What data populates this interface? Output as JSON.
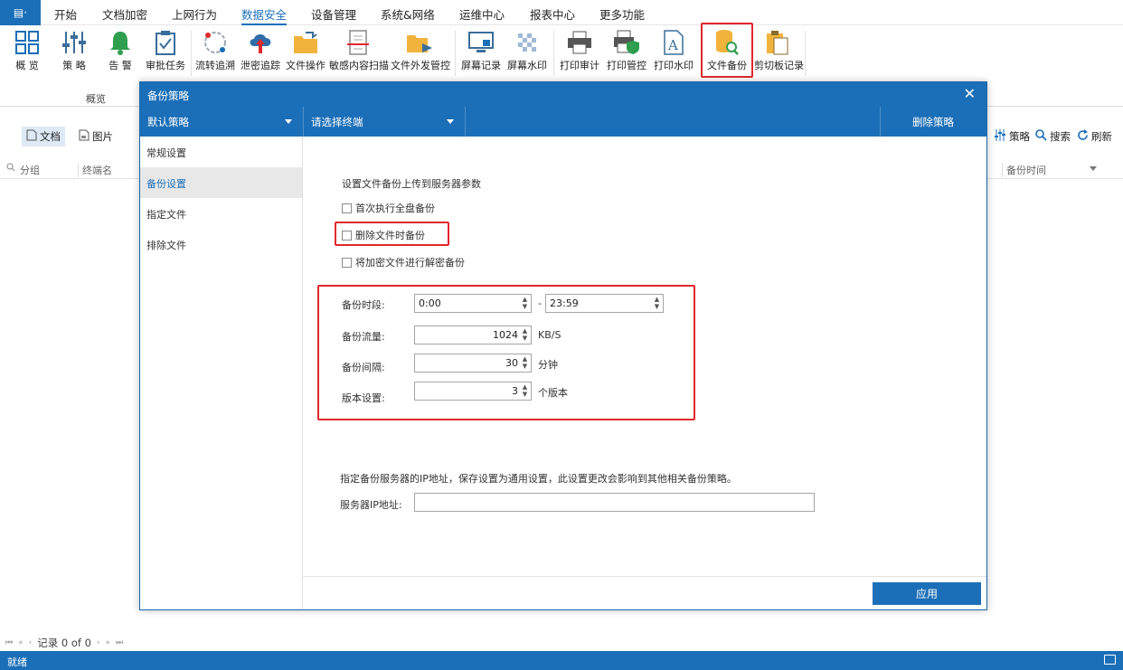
{
  "menubar": {
    "app_button": "▤·",
    "items": [
      "开始",
      "文档加密",
      "上网行为",
      "数据安全",
      "设备管理",
      "系统&网络",
      "运维中心",
      "报表中心",
      "更多功能"
    ],
    "active_index": 3
  },
  "ribbon": {
    "buttons": [
      {
        "label": "概 览",
        "icon": "overview-grid-icon"
      },
      {
        "label": "策 略",
        "icon": "sliders-icon"
      },
      {
        "label": "告 警",
        "icon": "bell-icon"
      },
      {
        "label": "审批任务",
        "icon": "clipboard-check-icon"
      },
      {
        "label": "流转追溯",
        "icon": "trace-circle-icon"
      },
      {
        "label": "泄密追踪",
        "icon": "cloud-upload-icon"
      },
      {
        "label": "文件操作",
        "icon": "folder-icon"
      },
      {
        "label": "敏感内容扫描",
        "icon": "document-scan-icon"
      },
      {
        "label": "文件外发管控",
        "icon": "folder-arrow-icon"
      },
      {
        "label": "屏幕记录",
        "icon": "monitor-icon"
      },
      {
        "label": "屏幕水印",
        "icon": "checker-icon"
      },
      {
        "label": "打印审计",
        "icon": "printer-icon"
      },
      {
        "label": "打印管控",
        "icon": "printer-shield-icon"
      },
      {
        "label": "打印水印",
        "icon": "document-a-icon"
      },
      {
        "label": "文件备份",
        "icon": "database-search-icon"
      },
      {
        "label": "剪切板记录",
        "icon": "clipboard-icon"
      }
    ],
    "selected_index": 14,
    "group_label": "概览"
  },
  "toolbar": {
    "doc": "文档",
    "image": "图片",
    "policy": "策略",
    "search": "搜索",
    "refresh": "刷新"
  },
  "columns": {
    "group": "分组",
    "terminal": "终端名",
    "backup_time": "备份时间"
  },
  "pager": {
    "text": "记录 0 of 0"
  },
  "status": {
    "text": "就绪"
  },
  "dialog": {
    "title": "备份策略",
    "close": "✕",
    "policy_select": "默认策略",
    "terminal_select": "请选择终端",
    "delete_policy": "删除策略",
    "nav": [
      "常规设置",
      "备份设置",
      "指定文件",
      "排除文件"
    ],
    "nav_active_index": 1,
    "section_title": "设置文件备份上传到服务器参数",
    "options": [
      {
        "label": "首次执行全盘备份",
        "checked": false
      },
      {
        "label": "删除文件时备份",
        "checked": false
      },
      {
        "label": "将加密文件进行解密备份",
        "checked": false
      }
    ],
    "fields": {
      "period_label": "备份时段:",
      "period_start": "0:00",
      "period_dash": "-",
      "period_end": "23:59",
      "rate_label": "备份流量:",
      "rate_value": "1024",
      "rate_unit": "KB/S",
      "interval_label": "备份间隔:",
      "interval_value": "30",
      "interval_unit": "分钟",
      "version_label": "版本设置:",
      "version_value": "3",
      "version_unit": "个版本"
    },
    "server_note": "指定备份服务器的IP地址，保存设置为通用设置，此设置更改会影响到其他相关备份策略。",
    "server_ip_label": "服务器IP地址:",
    "server_ip_value": "",
    "apply": "应用"
  },
  "colors": {
    "accent": "#1b6fb8",
    "highlight": "#e0282e"
  }
}
